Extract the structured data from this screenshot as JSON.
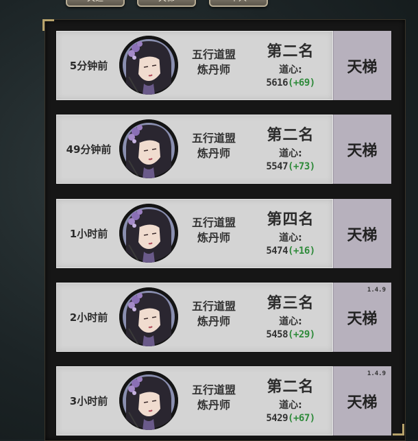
{
  "top_tabs": [
    {
      "label": "天选"
    },
    {
      "label": "天梯"
    },
    {
      "label": "个人"
    }
  ],
  "records": [
    {
      "time": "5分钟前",
      "player": {
        "line1": "五行道盟",
        "line2": "炼丹师"
      },
      "rank": "第二名",
      "heart_label": "道心:",
      "score": "5616",
      "delta": "(+69)",
      "mode": "天梯",
      "version": ""
    },
    {
      "time": "49分钟前",
      "player": {
        "line1": "五行道盟",
        "line2": "炼丹师"
      },
      "rank": "第二名",
      "heart_label": "道心:",
      "score": "5547",
      "delta": "(+73)",
      "mode": "天梯",
      "version": ""
    },
    {
      "time": "1小时前",
      "player": {
        "line1": "五行道盟",
        "line2": "炼丹师"
      },
      "rank": "第四名",
      "heart_label": "道心:",
      "score": "5474",
      "delta": "(+16)",
      "mode": "天梯",
      "version": ""
    },
    {
      "time": "2小时前",
      "player": {
        "line1": "五行道盟",
        "line2": "炼丹师"
      },
      "rank": "第三名",
      "heart_label": "道心:",
      "score": "5458",
      "delta": "(+29)",
      "mode": "天梯",
      "version": "1.4.9"
    },
    {
      "time": "3小时前",
      "player": {
        "line1": "五行道盟",
        "line2": "炼丹师"
      },
      "rank": "第二名",
      "heart_label": "道心:",
      "score": "5429",
      "delta": "(+67)",
      "mode": "天梯",
      "version": "1.4.9"
    }
  ],
  "colors": {
    "card_bg": "#d4d4d4",
    "side_bg": "#b7b1bd",
    "delta_green": "#2e8a3a",
    "panel_bg": "#161616"
  }
}
